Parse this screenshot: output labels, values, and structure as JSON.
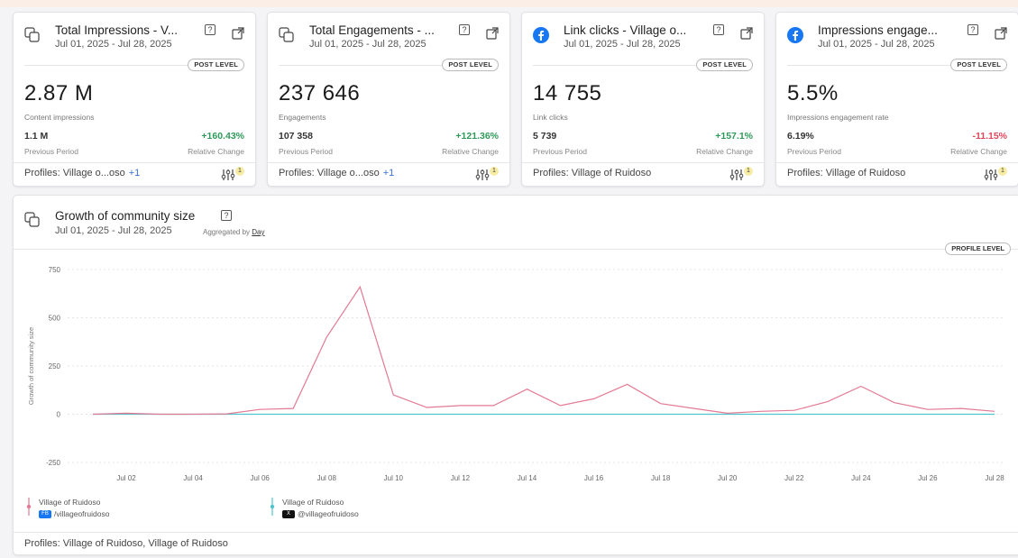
{
  "colors": {
    "pink": "#e27a93",
    "teal": "#4fc4cc",
    "facebook": "#1877f2",
    "up": "#2e9a5a",
    "down": "#e0465a"
  },
  "cards": [
    {
      "icon": "multi-profile-icon",
      "title": "Total Impressions - V...",
      "date": "Jul 01, 2025 - Jul 28, 2025",
      "level": "POST LEVEL",
      "value": "2.87 M",
      "sub": "Content impressions",
      "prev": "1.1 M",
      "prev_label": "Previous Period",
      "change": "+160.43%",
      "change_dir": "up",
      "change_label": "Relative Change",
      "profiles": "Profiles: Village o...oso",
      "profiles_more": "+1",
      "filter_count": "1"
    },
    {
      "icon": "multi-profile-icon",
      "title": "Total Engagements - ...",
      "date": "Jul 01, 2025 - Jul 28, 2025",
      "level": "POST LEVEL",
      "value": "237 646",
      "sub": "Engagements",
      "prev": "107 358",
      "prev_label": "Previous Period",
      "change": "+121.36%",
      "change_dir": "up",
      "change_label": "Relative Change",
      "profiles": "Profiles: Village o...oso",
      "profiles_more": "+1",
      "filter_count": "1"
    },
    {
      "icon": "facebook-icon",
      "title": "Link clicks - Village o...",
      "date": "Jul 01, 2025 - Jul 28, 2025",
      "level": "POST LEVEL",
      "value": "14 755",
      "sub": "Link clicks",
      "prev": "5 739",
      "prev_label": "Previous Period",
      "change": "+157.1%",
      "change_dir": "up",
      "change_label": "Relative Change",
      "profiles": "Profiles: Village of Ruidoso",
      "profiles_more": "",
      "filter_count": "1"
    },
    {
      "icon": "facebook-icon",
      "title": "Impressions engage...",
      "date": "Jul 01, 2025 - Jul 28, 2025",
      "level": "POST LEVEL",
      "value": "5.5%",
      "sub": "Impressions engagement rate",
      "prev": "6.19%",
      "prev_label": "Previous Period",
      "change": "-11.15%",
      "change_dir": "down",
      "change_label": "Relative Change",
      "profiles": "Profiles: Village of Ruidoso",
      "profiles_more": "",
      "filter_count": "1"
    }
  ],
  "growth": {
    "title": "Growth of community size",
    "date": "Jul 01, 2025 - Jul 28, 2025",
    "agg_label": "Aggregated by",
    "agg_value": "Day",
    "level": "PROFILE LEVEL",
    "profiles": "Profiles: Village of Ruidoso, Village of Ruidoso",
    "legend": [
      {
        "name": "Village of Ruidoso",
        "network": "FB",
        "handle": "/villageofruidoso",
        "color": "#e27a93"
      },
      {
        "name": "Village of Ruidoso",
        "network": "X",
        "handle": "@villageofruidoso",
        "color": "#4fc4cc"
      }
    ]
  },
  "chart_data": {
    "type": "line",
    "title": "Growth of community size",
    "xlabel": "",
    "ylabel": "Growth of community size",
    "x_ticks": [
      "Jul 02",
      "Jul 04",
      "Jul 06",
      "Jul 08",
      "Jul 10",
      "Jul 12",
      "Jul 14",
      "Jul 16",
      "Jul 18",
      "Jul 20",
      "Jul 22",
      "Jul 24",
      "Jul 26",
      "Jul 28"
    ],
    "y_ticks": [
      -250,
      0,
      250,
      500,
      750
    ],
    "ylim": [
      -250,
      750
    ],
    "grid": true,
    "legend_position": "bottom-left",
    "x": [
      "Jul 01",
      "Jul 02",
      "Jul 03",
      "Jul 04",
      "Jul 05",
      "Jul 06",
      "Jul 07",
      "Jul 08",
      "Jul 09",
      "Jul 10",
      "Jul 11",
      "Jul 12",
      "Jul 13",
      "Jul 14",
      "Jul 15",
      "Jul 16",
      "Jul 17",
      "Jul 18",
      "Jul 19",
      "Jul 20",
      "Jul 21",
      "Jul 22",
      "Jul 23",
      "Jul 24",
      "Jul 25",
      "Jul 26",
      "Jul 27",
      "Jul 28"
    ],
    "series": [
      {
        "name": "Village of Ruidoso /villageofruidoso",
        "color": "#e27a93",
        "values": [
          0,
          5,
          0,
          0,
          2,
          25,
          30,
          400,
          660,
          100,
          35,
          45,
          45,
          130,
          45,
          80,
          155,
          55,
          30,
          5,
          15,
          20,
          65,
          145,
          60,
          25,
          30,
          15
        ]
      },
      {
        "name": "Village of Ruidoso @villageofruidoso",
        "color": "#4fc4cc",
        "values": [
          0,
          0,
          0,
          0,
          0,
          0,
          0,
          0,
          0,
          0,
          0,
          0,
          0,
          0,
          0,
          0,
          0,
          0,
          0,
          0,
          0,
          0,
          0,
          0,
          0,
          0,
          0,
          0
        ]
      }
    ]
  }
}
